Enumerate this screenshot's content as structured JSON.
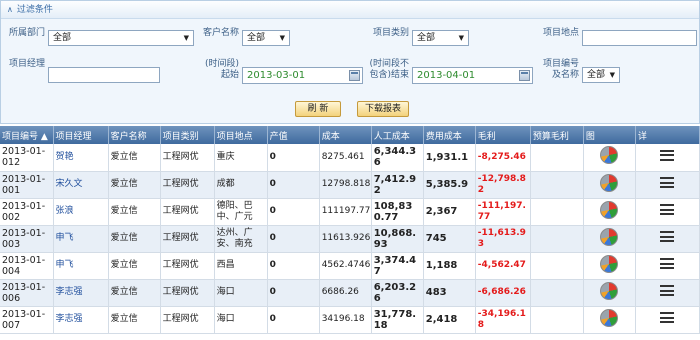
{
  "filter": {
    "header": "过滤条件",
    "dept_label": "所属部门",
    "dept_value": "全部",
    "customer_label": "客户名称",
    "customer_value": "全部",
    "type_label": "项目类别",
    "type_value": "全部",
    "location_label": "项目地点",
    "location_value": "",
    "manager_label": "项目经理",
    "manager_value": "",
    "start_label": "(时间段)起始",
    "start_value": "2013-03-01",
    "end_label": "(时间段不包含)结束",
    "end_value": "2013-04-01",
    "project_label": "项目编号及名称",
    "project_value": "全部",
    "refresh_label": "刷 新",
    "download_label": "下载报表"
  },
  "table": {
    "columns": [
      "项目编号 ▲",
      "项目经理",
      "客户名称",
      "项目类别",
      "项目地点",
      "产值",
      "成本",
      "人工成本",
      "费用成本",
      "毛利",
      "预算毛利",
      "图",
      "详"
    ],
    "rows": [
      {
        "code": "2013-01-012",
        "manager": "贺艳",
        "customer": "爱立信",
        "type": "工程网优",
        "location": "重庆",
        "output": "0",
        "cost": "8275.461",
        "labor": "6,344.36",
        "expense": "1,931.1",
        "profit": "-8,275.46"
      },
      {
        "code": "2013-01-001",
        "manager": "宋久文",
        "customer": "爱立信",
        "type": "工程网优",
        "location": "成都",
        "output": "0",
        "cost": "12798.818",
        "labor": "7,412.92",
        "expense": "5,385.9",
        "profit": "-12,798.82"
      },
      {
        "code": "2013-01-002",
        "manager": "张浪",
        "customer": "爱立信",
        "type": "工程网优",
        "location": "德阳、巴中、广元",
        "output": "0",
        "cost": "111197.77",
        "labor": "108,830.77",
        "expense": "2,367",
        "profit": "-111,197.77"
      },
      {
        "code": "2013-01-003",
        "manager": "申飞",
        "customer": "爱立信",
        "type": "工程网优",
        "location": "达州、广安、南充",
        "output": "0",
        "cost": "11613.926",
        "labor": "10,868.93",
        "expense": "745",
        "profit": "-11,613.93"
      },
      {
        "code": "2013-01-004",
        "manager": "申飞",
        "customer": "爱立信",
        "type": "工程网优",
        "location": "西昌",
        "output": "0",
        "cost": "4562.4746",
        "labor": "3,374.47",
        "expense": "1,188",
        "profit": "-4,562.47"
      },
      {
        "code": "2013-01-006",
        "manager": "李志强",
        "customer": "爱立信",
        "type": "工程网优",
        "location": "海口",
        "output": "0",
        "cost": "6686.26",
        "labor": "6,203.26",
        "expense": "483",
        "profit": "-6,686.26"
      },
      {
        "code": "2013-01-007",
        "manager": "李志强",
        "customer": "爱立信",
        "type": "工程网优",
        "location": "海口",
        "output": "0",
        "cost": "34196.18",
        "labor": "31,778.18",
        "expense": "2,418",
        "profit": "-34,196.18"
      }
    ]
  }
}
